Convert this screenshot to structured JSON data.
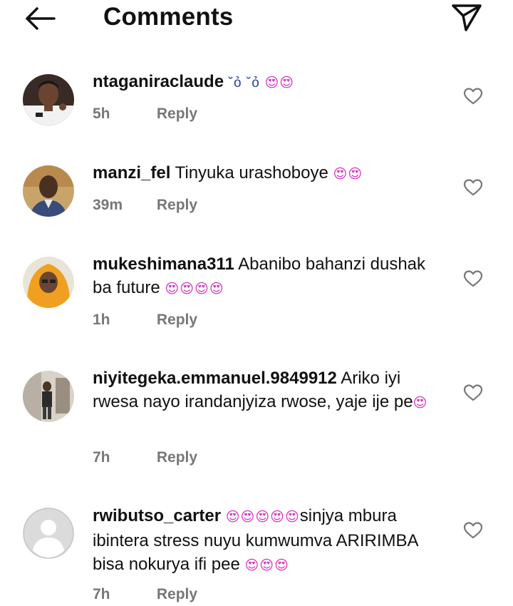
{
  "header": {
    "title": "Comments"
  },
  "reply_label": "Reply",
  "comments": [
    {
      "username": "ntaganiraclaude",
      "emoji_tear": "˘ỏ ˘ỏ",
      "text": "",
      "emoji": "😍😍",
      "time": "5h",
      "avatar": "player-photo"
    },
    {
      "username": "manzi_fel",
      "text": "Tinyuka urashoboye",
      "emoji": "😍😍",
      "time": "39m",
      "avatar": "man-photo"
    },
    {
      "username": "mukeshimana311",
      "text": "Abanibo bahanzi dushak ba future",
      "emoji": "😍😍😍😍",
      "time": "1h",
      "avatar": "woman-orange-scarf-photo"
    },
    {
      "username": "niyitegeka.emmanuel.9849912",
      "text": "Ariko iyi rwesa nayo irandanjyiza rwose, yaje ije pe",
      "emoji": "😍",
      "time": "7h",
      "avatar": "person-standing-photo"
    },
    {
      "username": "rwibutso_carter",
      "emoji_pre": "😍😍😍😍😍",
      "text": "sinjya mbura ibintera stress nuyu kumwumva ARIRIMBA bisa nokurya ifi pee",
      "emoji": "😍😍😍",
      "time": "7h",
      "avatar": "default-avatar"
    }
  ]
}
